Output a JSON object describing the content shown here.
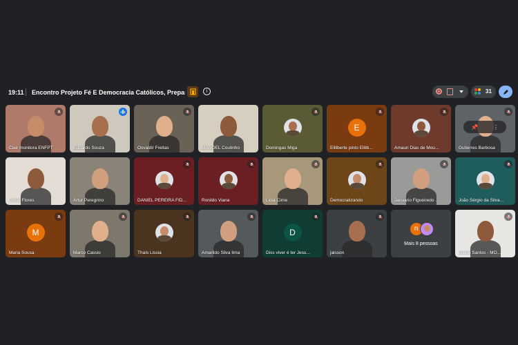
{
  "meeting": {
    "time": "19:11",
    "title": "Encontro Projeto Fé E Democracia Católicos, Prepar...",
    "participant_count": "31"
  },
  "colors": {
    "tile_dark": "#3c4043",
    "mic_off": "#ea4335",
    "speaking": "#1a73e8",
    "accent_blue": "#8ab4f8"
  },
  "tiles": [
    {
      "name": "Clair monitora ENFPT",
      "muted": true,
      "kind": "video",
      "bg": "#b07a6a"
    },
    {
      "name": "Eduardo Souza",
      "muted": false,
      "speaking": true,
      "kind": "video",
      "bg": "#cfc8bc"
    },
    {
      "name": "Osvaldir Freitas",
      "muted": true,
      "kind": "video",
      "bg": "#6b6257"
    },
    {
      "name": "MANOEL Coutinho",
      "muted": false,
      "kind": "video",
      "bg": "#d6cfc0"
    },
    {
      "name": "Domingas Miga",
      "muted": true,
      "kind": "avatar",
      "bg": "#5a5a35"
    },
    {
      "name": "Ellilberte pinto Ellilb...",
      "muted": true,
      "kind": "letter",
      "letter": "E",
      "bg": "#7a3b10",
      "circle": "#e8710a"
    },
    {
      "name": "Amauri Dias de Mou...",
      "muted": true,
      "kind": "avatar",
      "bg": "#6e3a2c"
    },
    {
      "name": "Gutierres Barbosa",
      "muted": true,
      "kind": "pinned",
      "bg": "#5f6368"
    },
    {
      "name": "Sonia Flores",
      "muted": false,
      "kind": "video",
      "bg": "#e4ddd6"
    },
    {
      "name": "Artur Peregrino",
      "muted": false,
      "kind": "video",
      "bg": "#8a8378"
    },
    {
      "name": "DANIEL PEREIRA FID...",
      "muted": true,
      "kind": "avatar",
      "bg": "#6b1f22"
    },
    {
      "name": "Ronildo Viana",
      "muted": true,
      "kind": "avatar",
      "bg": "#6b1f22"
    },
    {
      "name": "Lidia Cirne",
      "muted": true,
      "kind": "video",
      "bg": "#a7987c"
    },
    {
      "name": "Democratizando",
      "muted": true,
      "kind": "avatar",
      "bg": "#6e4518"
    },
    {
      "name": "Januario Figueiredo ...",
      "muted": true,
      "kind": "video",
      "bg": "#9a9a98"
    },
    {
      "name": "João Sérgio da Silva...",
      "muted": true,
      "kind": "avatar",
      "bg": "#1f5c5c"
    },
    {
      "name": "Maria Sousa",
      "muted": true,
      "kind": "letter",
      "letter": "M",
      "bg": "#7a3b10",
      "circle": "#e8710a"
    },
    {
      "name": "Marco Cassio",
      "muted": true,
      "kind": "video",
      "bg": "#7e786c"
    },
    {
      "name": "Thaís Lissia",
      "muted": true,
      "kind": "avatar",
      "bg": "#4a3420"
    },
    {
      "name": "Amarildo Silva lima",
      "muted": true,
      "kind": "video",
      "bg": "#55595c"
    },
    {
      "name": "Diss viver é ter Jesu...",
      "muted": true,
      "kind": "letter",
      "letter": "D",
      "bg": "#0f3d33",
      "circle": "#0b5345"
    },
    {
      "name": "jaisson",
      "muted": true,
      "kind": "video",
      "bg": "#3c4043"
    },
    {
      "name": "Mais 8 pessoas",
      "muted": false,
      "kind": "more",
      "letter": "n",
      "bg": "#3c4043"
    },
    {
      "name": "Bruna Santos - MO...",
      "muted": true,
      "kind": "video",
      "bg": "#e8e6e3"
    }
  ]
}
